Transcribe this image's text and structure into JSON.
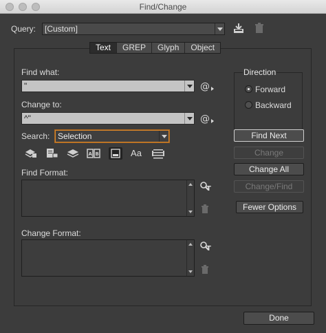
{
  "window": {
    "title": "Find/Change"
  },
  "query": {
    "label": "Query:",
    "value": "[Custom]"
  },
  "tabs": [
    {
      "label": "Text",
      "active": true
    },
    {
      "label": "GREP",
      "active": false
    },
    {
      "label": "Glyph",
      "active": false
    },
    {
      "label": "Object",
      "active": false
    }
  ],
  "find_what": {
    "label": "Find what:",
    "value": "\""
  },
  "change_to": {
    "label": "Change to:",
    "value": "^\""
  },
  "search": {
    "label": "Search:",
    "value": "Selection"
  },
  "find_format": {
    "label": "Find Format:"
  },
  "change_format": {
    "label": "Change Format:"
  },
  "direction": {
    "title": "Direction",
    "options": [
      {
        "label": "Forward",
        "selected": true
      },
      {
        "label": "Backward",
        "selected": false
      }
    ]
  },
  "buttons": {
    "find_next": "Find Next",
    "change": "Change",
    "change_all": "Change All",
    "change_find": "Change/Find",
    "fewer_options": "Fewer Options",
    "done": "Done"
  },
  "toolbar": {
    "icons": [
      "include-locked-layers-icon",
      "include-locked-stories-icon",
      "include-hidden-layers-icon",
      "include-master-pages-icon",
      "include-footnotes-icon",
      "case-sensitive-icon",
      "whole-word-icon"
    ],
    "case_glyph": "Aa"
  },
  "colors": {
    "search_focus": "#d6862b",
    "dialog_bg": "#3c3c3c"
  }
}
